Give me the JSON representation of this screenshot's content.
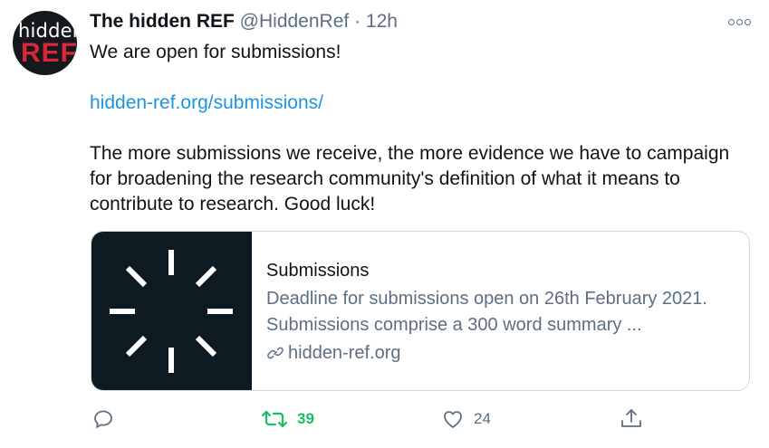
{
  "tweet": {
    "avatar": {
      "line1": "hidden",
      "line2": "REF"
    },
    "author_name": "The hidden REF",
    "handle": "@HiddenRef",
    "separator": "·",
    "time": "12h",
    "more_icon": "more-dots-icon",
    "text": {
      "line1": "We are open for submissions!",
      "link": "hidden-ref.org/submissions/",
      "paragraph": "The more submissions we receive, the more evidence we  have to campaign for broadening the research community's definition of what it means to contribute to research. Good luck!"
    },
    "card": {
      "title": "Submissions",
      "description": "Deadline for submissions open on 26th February 2021. Submissions comprise a 300 word summary ...",
      "domain": "hidden-ref.org",
      "link_icon": "link-icon"
    },
    "actions": {
      "reply_icon": "reply-icon",
      "retweet_icon": "retweet-icon",
      "retweet_count": "39",
      "like_icon": "heart-icon",
      "like_count": "24",
      "share_icon": "share-icon"
    },
    "colors": {
      "link": "#1b95e0",
      "secondary": "#5b7083",
      "retweet_active": "#17bf63",
      "card_border": "#cfd9de",
      "card_image_bg": "#0d1a21",
      "avatar_bg": "#15181c",
      "avatar_accent": "#d8263b"
    }
  }
}
